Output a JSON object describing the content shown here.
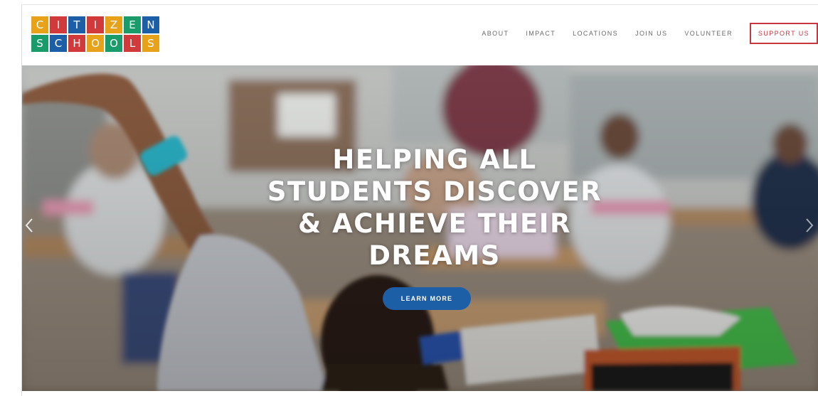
{
  "logo": {
    "row1": [
      "C",
      "I",
      "T",
      "I",
      "Z",
      "E",
      "N"
    ],
    "row2": [
      "S",
      "C",
      "H",
      "O",
      "O",
      "L",
      "S"
    ],
    "row1_colors": [
      "#e8a21a",
      "#d13a3a",
      "#1d5fa6",
      "#d13a3a",
      "#e8a21a",
      "#1a9b6a",
      "#1d5fa6"
    ],
    "row2_colors": [
      "#1a9b6a",
      "#1d5fa6",
      "#d13a3a",
      "#e8a21a",
      "#1a9b6a",
      "#d13a3a",
      "#e8a21a"
    ]
  },
  "nav": {
    "about": "ABOUT",
    "impact": "IMPACT",
    "locations": "LOCATIONS",
    "join_us": "JOIN US",
    "volunteer": "VOLUNTEER",
    "support_us": "SUPPORT US"
  },
  "hero": {
    "title_line1": "HELPING ALL",
    "title_line2": "STUDENTS DISCOVER",
    "title_line3": "& ACHIEVE THEIR",
    "title_line4": "DREAMS",
    "cta_label": "LEARN MORE",
    "prev_icon": "chevron-left-icon",
    "next_icon": "chevron-right-icon"
  },
  "colors": {
    "accent_red": "#c8363f",
    "button_blue": "#1d5fa6",
    "nav_text": "#6a6a6a"
  }
}
